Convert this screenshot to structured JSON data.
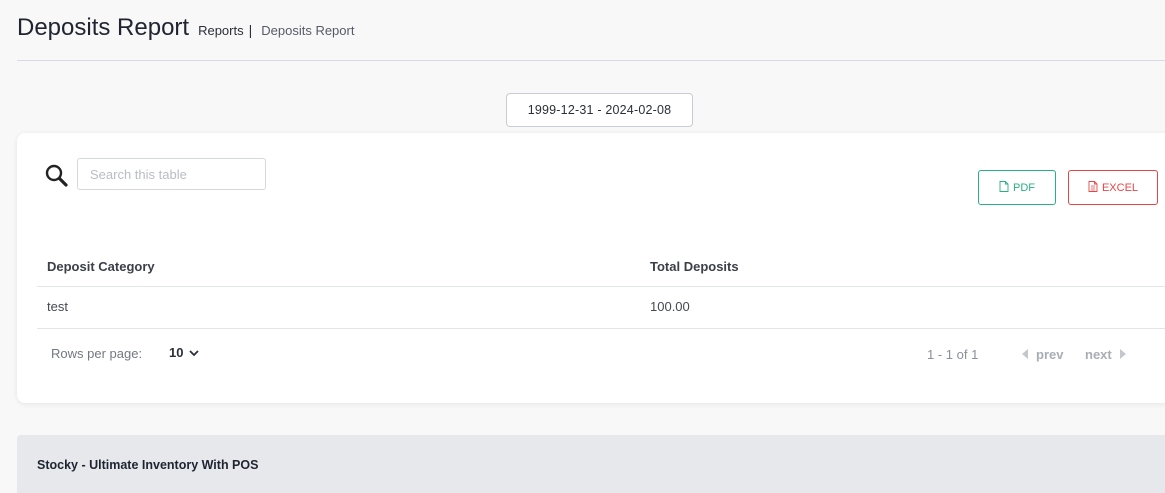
{
  "header": {
    "title": "Deposits Report",
    "breadcrumb": [
      "Reports",
      "Deposits Report"
    ],
    "separator": "|"
  },
  "date_range": "1999-12-31 - 2024-02-08",
  "toolbar": {
    "search_placeholder": "Search this table",
    "pdf_label": "PDF",
    "excel_label": "EXCEL",
    "pdf_color": "#28b083",
    "excel_color": "#e64545"
  },
  "table": {
    "columns": [
      "Deposit Category",
      "Total Deposits"
    ],
    "rows": [
      [
        "test",
        "100.00"
      ]
    ]
  },
  "pagination": {
    "rows_per_page_label": "Rows per page:",
    "rows_per_page": "10",
    "range_text": "1 - 1 of 1",
    "prev_label": "prev",
    "next_label": "next"
  },
  "footer": {
    "app_name": "Stocky - Ultimate Inventory With POS"
  }
}
